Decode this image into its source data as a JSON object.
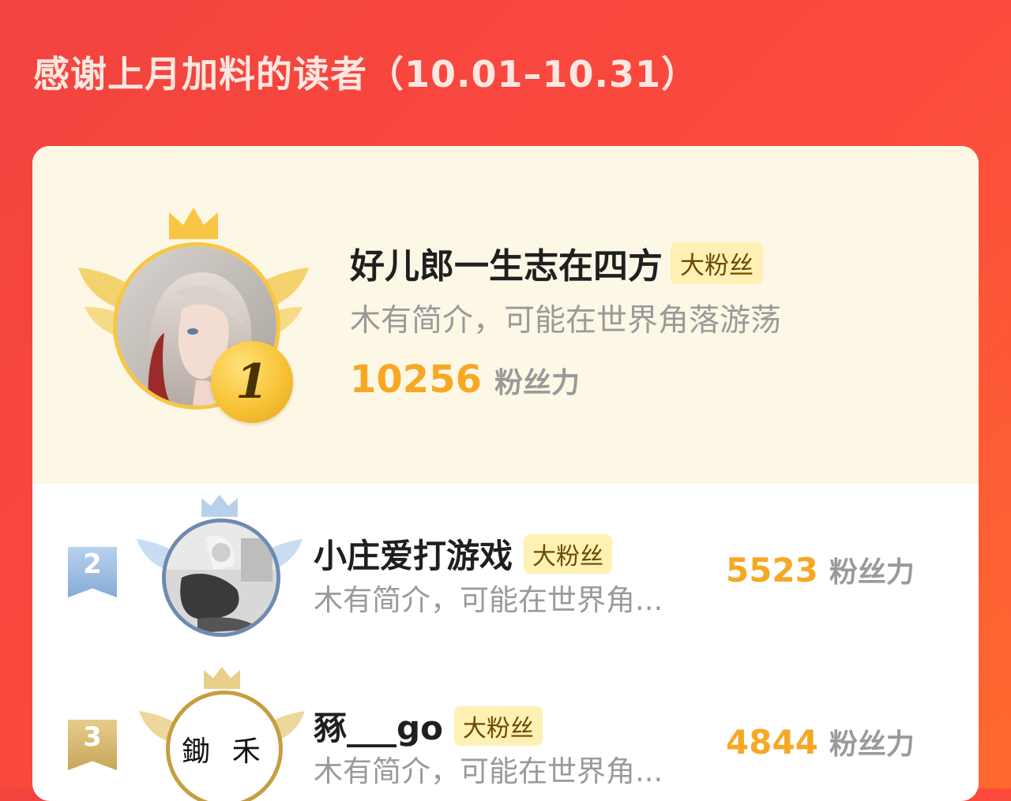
{
  "header": {
    "title": "感谢上月加料的读者（10.01–10.31）"
  },
  "ranking": [
    {
      "rank": "1",
      "name": "好儿郎一生志在四方",
      "badge": "大粉丝",
      "bio": "木有简介，可能在世界角落游荡",
      "power": "10256",
      "power_unit": "粉丝力",
      "avatar_icon": "anime-portrait-avatar"
    },
    {
      "rank": "2",
      "name": "小庄爱打游戏",
      "badge": "大粉丝",
      "bio": "木有简介，可能在世界角...",
      "power": "5523",
      "power_unit": "粉丝力",
      "avatar_icon": "photo-avatar"
    },
    {
      "rank": "3",
      "name": "豩___go",
      "badge": "大粉丝",
      "bio": "木有简介，可能在世界角...",
      "power": "4844",
      "power_unit": "粉丝力",
      "avatar_icon": "calligraphy-avatar",
      "avatar_text": "鋤 禾"
    }
  ],
  "colors": {
    "background_start": "#f2433f",
    "background_end": "#ff6a2e",
    "gold": "#f8c644",
    "silver": "#9bb8e0",
    "bronze": "#d9bb6e",
    "power": "#f6a825"
  }
}
